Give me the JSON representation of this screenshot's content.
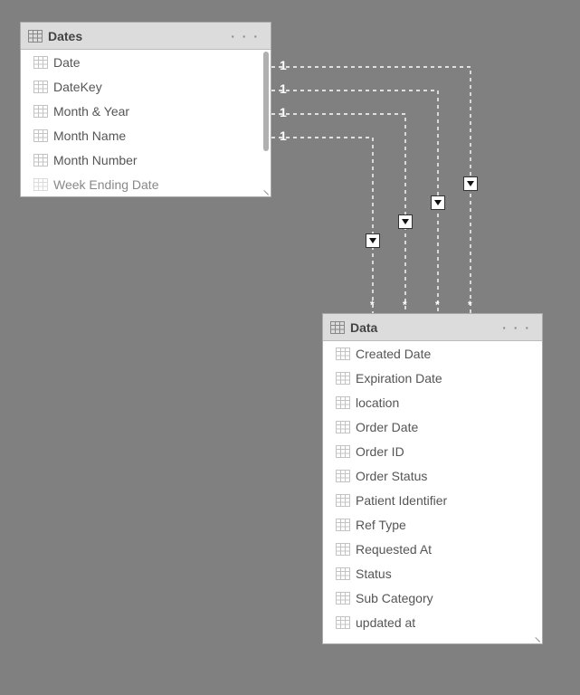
{
  "tables": {
    "dates": {
      "title": "Dates",
      "fields": [
        "Date",
        "DateKey",
        "Month & Year",
        "Month Name",
        "Month Number",
        "Week Ending Date"
      ]
    },
    "data": {
      "title": "Data",
      "fields": [
        "Created Date",
        "Expiration Date",
        "location",
        "Order Date",
        "Order ID",
        "Order Status",
        "Patient Identifier",
        "Ref Type",
        "Requested At",
        "Status",
        "Sub Category",
        "updated at"
      ]
    }
  },
  "relationships": {
    "from_cardinality": "1",
    "to_cardinality": "*",
    "count": 4,
    "filter_direction": "single"
  },
  "menu": "· · ·"
}
